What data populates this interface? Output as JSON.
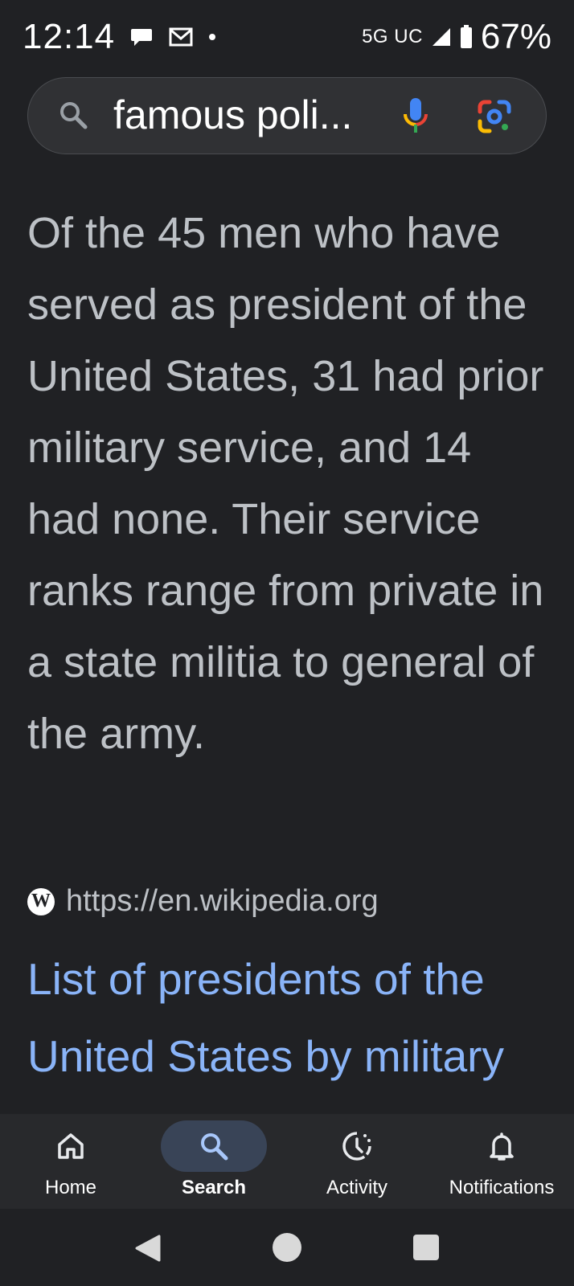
{
  "status_bar": {
    "time": "12:14",
    "network": "5G UC",
    "battery": "67%"
  },
  "search": {
    "query": "famous poli..."
  },
  "snippet": {
    "text": "Of the 45 men who have served as president of the United States, 31 had prior military service, and 14 had none. Their service ranks range from private in a state militia to general of the army."
  },
  "source": {
    "badge": "W",
    "url": "https://en.wikipedia.org"
  },
  "result": {
    "title": "List of presidents of the United States by military"
  },
  "bottom_nav": {
    "items": [
      {
        "label": "Home",
        "icon": "home-icon"
      },
      {
        "label": "Search",
        "icon": "search-icon",
        "active": true
      },
      {
        "label": "Activity",
        "icon": "activity-icon"
      },
      {
        "label": "Notifications",
        "icon": "bell-icon"
      }
    ]
  },
  "colors": {
    "background": "#202124",
    "link": "#8ab4f8",
    "text": "#bdc1c6",
    "active_pill": "#394457"
  }
}
